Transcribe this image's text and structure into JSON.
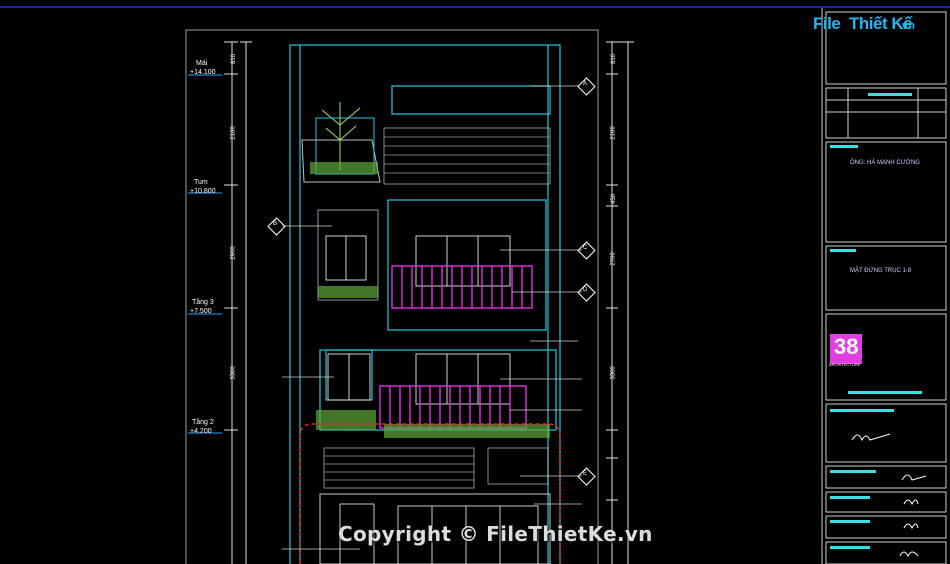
{
  "window": {
    "background": "#000000",
    "accent_bar": "#1a22c8"
  },
  "logo": {
    "part1": "File",
    "part2": "Thiết Kế",
    "suffix": ".vn",
    "color": "#28b4f0"
  },
  "levels": [
    {
      "name": "Mái",
      "value": "+14.100"
    },
    {
      "name": "Tum",
      "value": "+10.800"
    },
    {
      "name": "Tầng 3",
      "value": "+7.500"
    },
    {
      "name": "Tầng 2",
      "value": "+4.200"
    }
  ],
  "dimensions_left": [
    "810",
    "2100",
    "2900",
    "3300",
    "3300",
    "3300",
    "3400"
  ],
  "dimensions_right": [
    "810",
    "2100",
    "450",
    "2700",
    "3300",
    "3300",
    "1200",
    "2100"
  ],
  "callouts": [
    "A",
    "B",
    "C",
    "D",
    "E"
  ],
  "title_block": {
    "owner": "ÔNG: HÀ MẠNH CƯỜNG",
    "drawing_name": "MẶT ĐỨNG TRỤC 1-8",
    "company_logo_text": "38",
    "company_tag": "ARCHITECTURE"
  },
  "watermark": "Copyright © FileThietKe.vn"
}
